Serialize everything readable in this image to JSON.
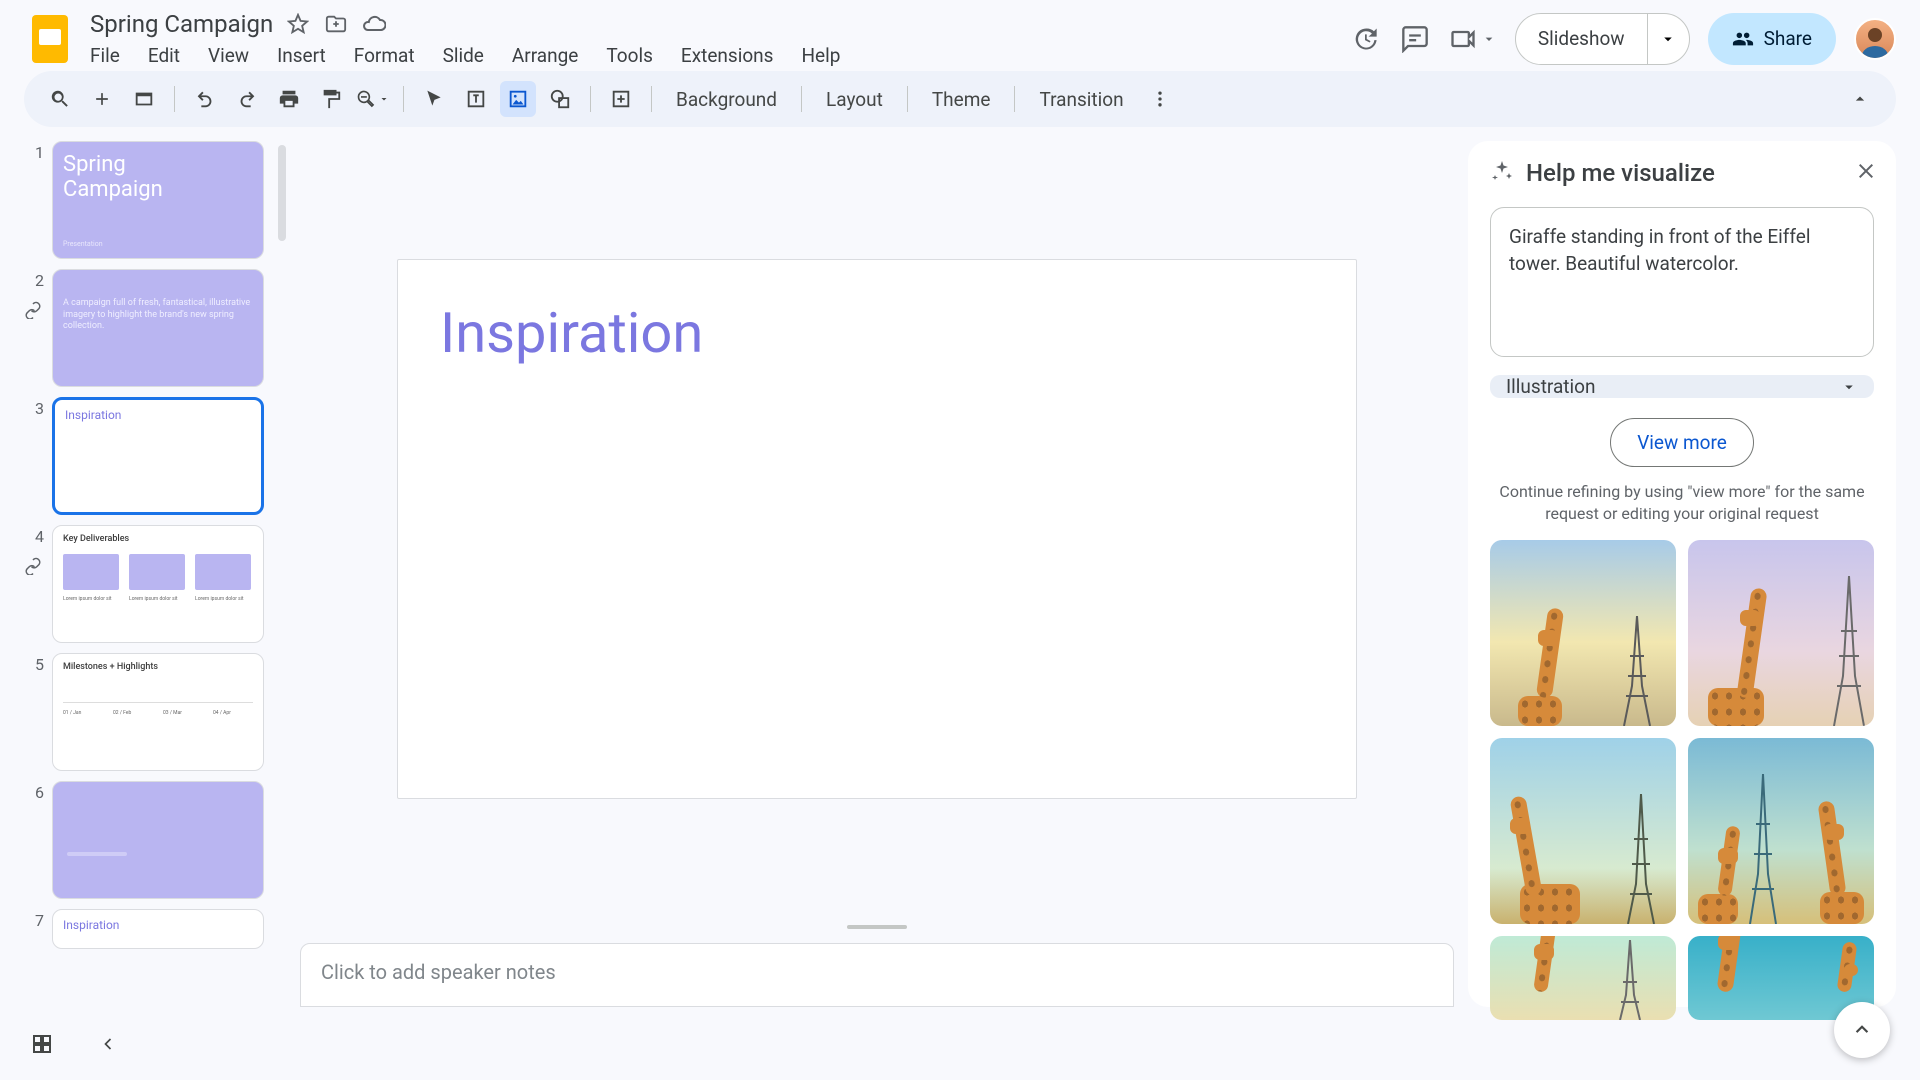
{
  "doc": {
    "title": "Spring Campaign"
  },
  "menu": {
    "file": "File",
    "edit": "Edit",
    "view": "View",
    "insert": "Insert",
    "format": "Format",
    "slide": "Slide",
    "arrange": "Arrange",
    "tools": "Tools",
    "extensions": "Extensions",
    "help": "Help"
  },
  "header_buttons": {
    "slideshow": "Slideshow",
    "share": "Share"
  },
  "toolbar_text": {
    "background": "Background",
    "layout": "Layout",
    "theme": "Theme",
    "transition": "Transition"
  },
  "filmstrip": {
    "slides": [
      {
        "n": "1",
        "title": "Spring\nCampaign",
        "sub": "Presentation"
      },
      {
        "n": "2",
        "body": "A campaign full of fresh, fantastical, illustrative imagery to highlight the brand's new spring collection."
      },
      {
        "n": "3",
        "small_title": "Inspiration"
      },
      {
        "n": "4",
        "kd_title": "Key Deliverables"
      },
      {
        "n": "5",
        "kd_title": "Milestones + Highlights"
      },
      {
        "n": "6"
      },
      {
        "n": "7",
        "small_title": "Inspiration"
      }
    ]
  },
  "canvas": {
    "headline": "Inspiration"
  },
  "notes": {
    "placeholder": "Click to add speaker notes"
  },
  "sidepanel": {
    "title": "Help me visualize",
    "prompt": "Giraffe standing in front of the Eiffel tower. Beautiful watercolor.",
    "style": "Illustration",
    "view_more": "View more",
    "refine": "Continue refining by using \"view more\" for the same request or editing your original request"
  }
}
